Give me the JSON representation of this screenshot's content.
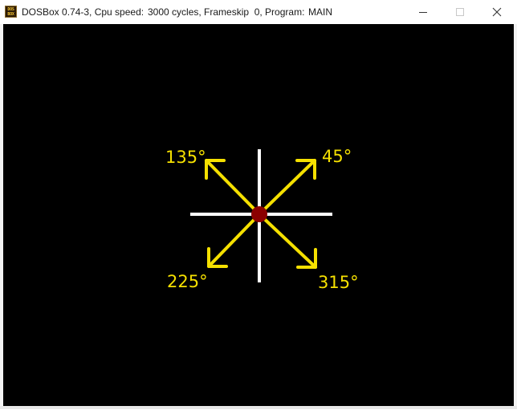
{
  "window": {
    "app_title": "DOSBox 0.74-3, Cpu speed:",
    "cycles_text": "3000 cycles, Frameskip  0, Program:",
    "program_name": "MAIN",
    "icon_text_top": "DOS",
    "icon_text_bottom": "BOX"
  },
  "diagram": {
    "labels": {
      "a45": "45°",
      "a135": "135°",
      "a225": "225°",
      "a315": "315°"
    },
    "colors": {
      "axes": "#ffffff",
      "arrows": "#f5e000",
      "center_dot": "#8b0000",
      "background": "#000000"
    }
  }
}
